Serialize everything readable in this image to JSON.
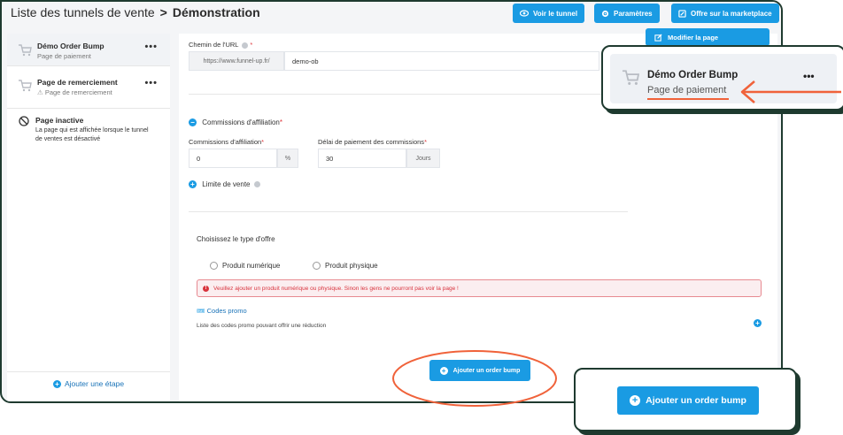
{
  "header": {
    "breadcrumb_parent": "Liste des tunnels de vente",
    "breadcrumb_sep": ">",
    "breadcrumb_current": "Démonstration",
    "buttons": {
      "view": "Voir le tunnel",
      "settings": "Paramètres",
      "marketplace": "Offre sur la marketplace"
    }
  },
  "sidebar": {
    "items": [
      {
        "title": "Démo Order Bump",
        "subtitle": "Page de paiement",
        "menu": "•••"
      },
      {
        "title": "Page de remerciement",
        "subtitle": "Page de remerciement",
        "menu": "•••"
      },
      {
        "title": "Page inactive",
        "subtitle": "La page qui est affichée lorsque le tunnel de ventes est désactivé"
      }
    ],
    "add_step": "Ajouter une étape"
  },
  "main": {
    "edit_page_button": "Modifier la page",
    "url_label": "Chemin de l'URL",
    "url_prefix": "https://www.funnel-up.fr/",
    "url_value": "demo-ob",
    "affiliation_toggle": "Commissions d'affiliation",
    "commission_label": "Commissions d'affiliation",
    "commission_value": "0",
    "commission_unit": "%",
    "delay_label": "Délai de paiement des commissions",
    "delay_value": "30",
    "delay_unit": "Jours",
    "sale_limit": "Limite de vente",
    "offer_type_label": "Choisissez le type d'offre",
    "offer_options": [
      "Produit numérique",
      "Produit physique"
    ],
    "error_message": "Veuillez ajouter un produit numérique ou physique. Sinon les gens ne pourront pas voir la page !",
    "promo_codes_title": "Codes promo",
    "promo_codes_desc": "Liste des codes promo pouvant offrir une réduction",
    "add_order_bump": "Ajouter un order bump"
  },
  "callouts": {
    "page_card_title": "Démo Order Bump",
    "page_card_subtitle": "Page de paiement",
    "page_card_menu": "•••",
    "button_label": "Ajouter un order bump"
  },
  "colors": {
    "primary": "#1a9be3",
    "annotation": "#f0623a",
    "frame": "#1e3a2f",
    "error": "#d8333d"
  }
}
